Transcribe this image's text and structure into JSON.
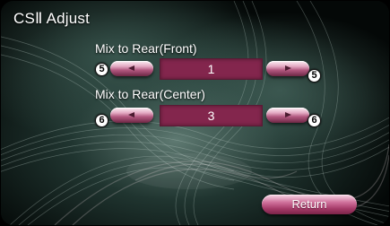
{
  "window": {
    "title": "CSⅡ Adjust"
  },
  "rows": [
    {
      "label": "Mix to Rear(Front)",
      "value": "1",
      "badge": "5"
    },
    {
      "label": "Mix to Rear(Center)",
      "value": "3",
      "badge": "6"
    }
  ],
  "footer": {
    "return_label": "Return"
  },
  "icons": {
    "decrease": "left-arrow-icon",
    "increase": "right-arrow-icon"
  },
  "colors": {
    "accent": "#83264d",
    "button_light": "#e3a9c2",
    "button_dark": "#6d2744"
  }
}
